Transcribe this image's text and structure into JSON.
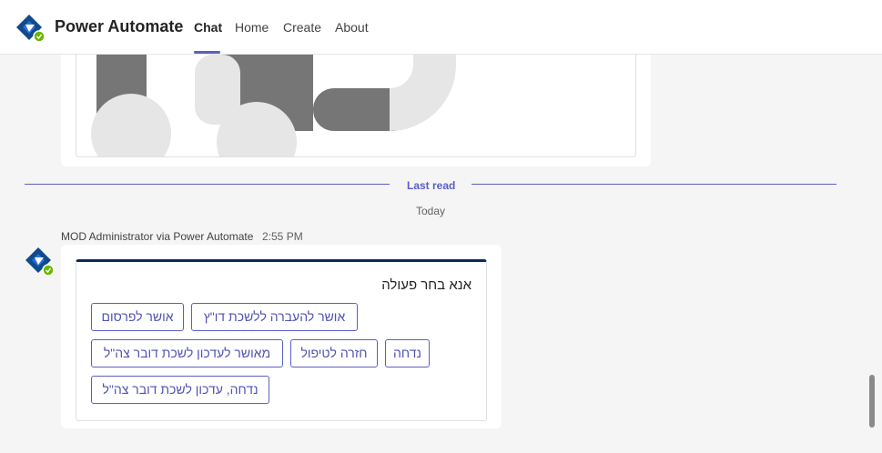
{
  "header": {
    "app_title": "Power Automate",
    "tabs": [
      {
        "label": "Chat",
        "active": true
      },
      {
        "label": "Home",
        "active": false
      },
      {
        "label": "Create",
        "active": false
      },
      {
        "label": "About",
        "active": false
      }
    ],
    "icon": "power-automate-logo",
    "status_color": "#6bb700",
    "accent_color": "#5b5fc7"
  },
  "divider": {
    "last_read_label": "Last read",
    "date_label": "Today"
  },
  "message": {
    "sender": "MOD Administrator via Power Automate",
    "time": "2:55 PM",
    "card": {
      "prompt": "אנא בחר פעולה",
      "actions": [
        "אושר להעברה ללשכת דו\"ץ",
        "אושר לפרסום",
        "נדחה",
        "חזרה לטיפול",
        "מאושר לעדכון לשכת דובר צה\"ל",
        "נדחה, עדכון לשכת דובר צה\"ל"
      ]
    }
  }
}
